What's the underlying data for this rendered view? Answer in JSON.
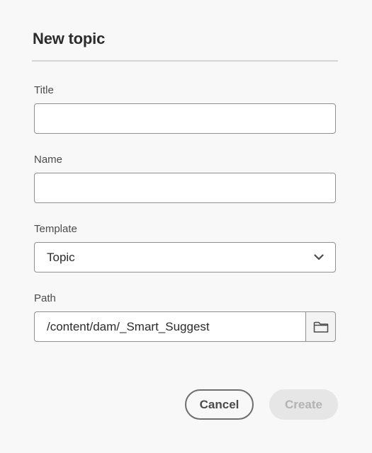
{
  "dialog": {
    "title": "New topic"
  },
  "fields": {
    "title": {
      "label": "Title",
      "value": "",
      "placeholder": ""
    },
    "name": {
      "label": "Name",
      "value": "",
      "placeholder": ""
    },
    "template": {
      "label": "Template",
      "selected": "Topic",
      "icon": "chevron-down-icon"
    },
    "path": {
      "label": "Path",
      "value": "/content/dam/_Smart_Suggest",
      "browse_icon": "folder-icon"
    }
  },
  "buttons": {
    "cancel_label": "Cancel",
    "create_label": "Create",
    "create_disabled": true
  },
  "colors": {
    "background": "#f8f8f8",
    "input_border": "#909090",
    "text": "#2c2c2c",
    "disabled_button_bg": "#e6e6e6",
    "disabled_button_text": "#b3b3b3"
  }
}
